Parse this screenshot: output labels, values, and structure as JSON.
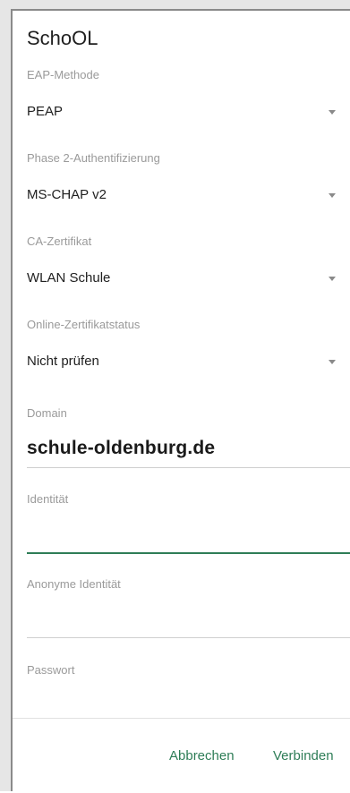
{
  "dialog": {
    "title": "SchoOL",
    "eap_method": {
      "label": "EAP-Methode",
      "value": "PEAP"
    },
    "phase2": {
      "label": "Phase 2-Authentifizierung",
      "value": "MS-CHAP v2"
    },
    "ca_cert": {
      "label": "CA-Zertifikat",
      "value": "WLAN Schule"
    },
    "online_status": {
      "label": "Online-Zertifikatstatus",
      "value": "Nicht prüfen"
    },
    "domain": {
      "label": "Domain",
      "value": "schule-oldenburg.de"
    },
    "identity": {
      "label": "Identität",
      "value": ""
    },
    "anonymous_identity": {
      "label": "Anonyme Identität",
      "value": ""
    },
    "password": {
      "label": "Passwort",
      "value": ""
    }
  },
  "actions": {
    "cancel": "Abbrechen",
    "connect": "Verbinden"
  },
  "colors": {
    "accent": "#2e7d57"
  },
  "icons": {
    "dropdown": "dropdown-arrow-icon"
  }
}
